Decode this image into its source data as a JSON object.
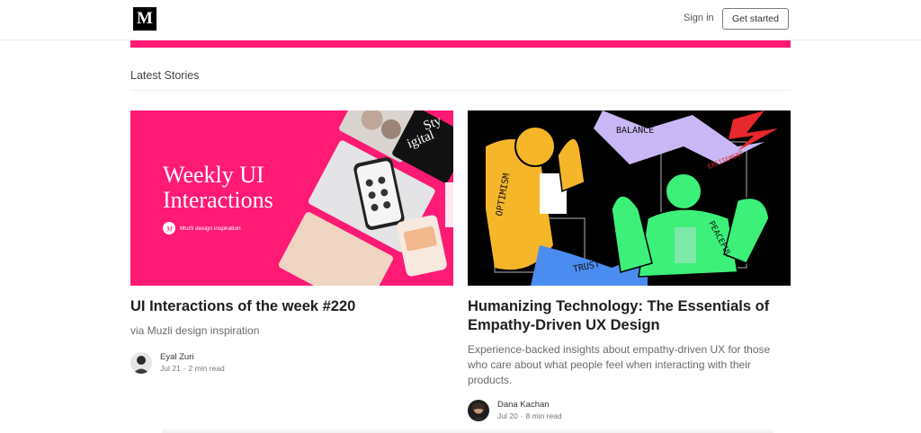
{
  "header": {
    "logo_letter": "M",
    "signin_label": "Sign in",
    "get_started_label": "Get started"
  },
  "section": {
    "title": "Latest Stories"
  },
  "stories": [
    {
      "thumbnail": {
        "headline_line1": "Weekly UI",
        "headline_line2": "Interactions",
        "brand_badge": "M",
        "brand_label": "Muzli design inspiration",
        "corner_text_1": "Sty",
        "corner_text_2": "igital",
        "bg_color": "#ff1a76"
      },
      "title": "UI Interactions of the week #220",
      "subtitle": "via Muzli design inspiration",
      "author": "Eyal Zuri",
      "date": "Jul 21",
      "read_time": "2 min read"
    },
    {
      "thumbnail": {
        "word_balance": "BALANCE",
        "word_optimism": "OPTIMISM",
        "word_trust": "TRUST",
        "word_peaceful": "PEACEFUL",
        "word_excitement": "EXCITEMENT",
        "bg_color": "#000000"
      },
      "title_line1": "Humanizing Technology: The Essentials of",
      "title_line2": "Empathy-Driven UX Design",
      "subtitle_line1": "Experience-backed insights about empathy-driven UX for those",
      "subtitle_line2": "who care about what people feel when interacting with their",
      "subtitle_line3": "products.",
      "author": "Dana Kachan",
      "date": "Jul 20",
      "read_time": "8 min read"
    }
  ],
  "colors": {
    "accent_pink": "#ff1a76",
    "text_dark": "#1f1f1f",
    "text_muted": "#6b6b6b"
  }
}
